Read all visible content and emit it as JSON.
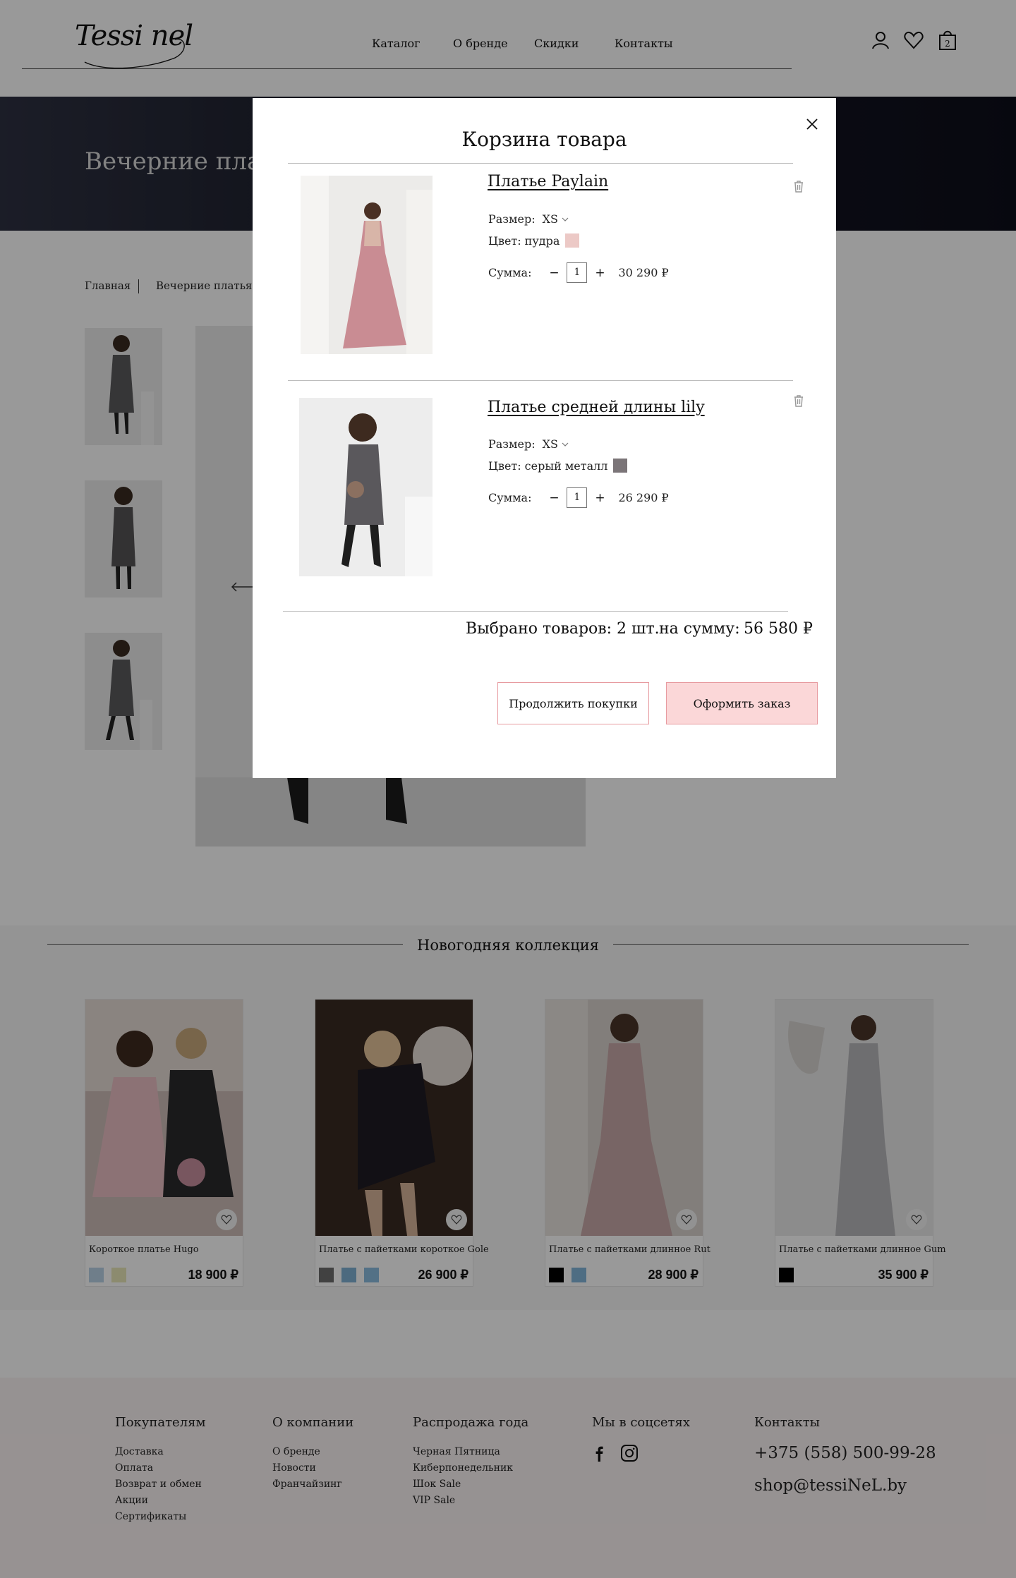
{
  "header": {
    "logo": "Tessi nel",
    "nav": [
      "Каталог",
      "О бренде",
      "Скидки",
      "Контакты"
    ],
    "cart_count": "2",
    "icons": [
      "user-icon",
      "heart-icon",
      "bag-icon"
    ]
  },
  "hero": {
    "title": "Вечерние платья"
  },
  "breadcrumbs": [
    "Главная",
    "Вечерние платья"
  ],
  "collection": {
    "title": "Новогодняя коллекция",
    "products": [
      {
        "name": "Короткое платье Hugo",
        "price": "18 900 ₽",
        "swatches": [
          "#b9d3e6",
          "#e9e8b9"
        ]
      },
      {
        "name": "Платье с пайетками короткое Gole",
        "price": "26 900 ₽",
        "swatches": [
          "#6d6d6d",
          "#7fb1d4",
          "#8bbcdf"
        ]
      },
      {
        "name": "Платье с пайетками длинное Rut",
        "price": "28 900 ₽",
        "swatches": [
          "#000000",
          "#83b6da"
        ]
      },
      {
        "name": "Платье с пайетками длинное Gum",
        "price": "35 900 ₽",
        "swatches": [
          "#000000"
        ]
      }
    ]
  },
  "footer": {
    "buyers": {
      "title": "Покупателям",
      "links": [
        "Доставка",
        "Оплата",
        "Возврат и обмен",
        "Акции",
        "Сертификаты"
      ]
    },
    "company": {
      "title": "О компании",
      "links": [
        "О бренде",
        "Новости",
        "Франчайзинг"
      ]
    },
    "sale": {
      "title": "Распродажа года",
      "links": [
        "Черная Пятница",
        "Киберпонедельник",
        "Шок Sale",
        "VIP Sale"
      ]
    },
    "social": {
      "title": "Мы в соцсетях",
      "icons": [
        "facebook-icon",
        "instagram-icon"
      ]
    },
    "contacts": {
      "title": "Контакты",
      "phone": "+375 (558) 500-99-28",
      "email": "shop@tessiNeL.by"
    }
  },
  "cart": {
    "title": "Корзина товара",
    "size_label": "Размер:",
    "color_label": "Цвет:",
    "sum_label": "Сумма:",
    "items": [
      {
        "name": "Платье Paylain",
        "size": "XS",
        "color_name": "пудра",
        "color": "#ecc9c6",
        "qty": "1",
        "price": "30 290 ₽"
      },
      {
        "name": "Платье средней длины lily",
        "size": "XS",
        "color_name": "серый металл",
        "color": "#7b7578",
        "qty": "1",
        "price": "26 290 ₽"
      }
    ],
    "selected_label": "Выбрано товаров: 2 шт.",
    "total_label": "на сумму:",
    "total": "56 580 ₽",
    "continue_button": "Продолжить покупки",
    "checkout_button": "Оформить заказ"
  }
}
